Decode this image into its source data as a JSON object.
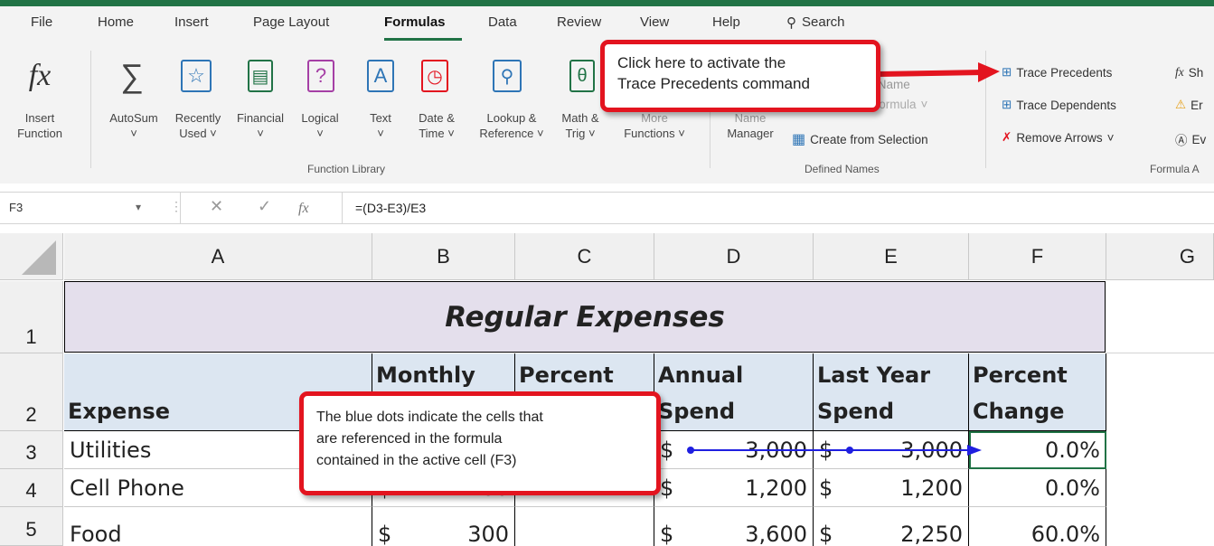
{
  "tabs": [
    "File",
    "Home",
    "Insert",
    "Page Layout",
    "Formulas",
    "Data",
    "Review",
    "View",
    "Help"
  ],
  "search_label": "Search",
  "ribbon": {
    "insert_function": [
      "Insert",
      "Function"
    ],
    "autosum": "AutoSum",
    "recently_used": [
      "Recently",
      "Used"
    ],
    "financial": "Financial",
    "logical": "Logical",
    "text": "Text",
    "date_time": [
      "Date &",
      "Time"
    ],
    "lookup_reference": [
      "Lookup &",
      "Reference"
    ],
    "math_trig": [
      "Math &",
      "Trig"
    ],
    "more_functions": [
      "More",
      "Functions"
    ],
    "function_library_label": "Function Library",
    "name_manager": [
      "Name",
      "Manager"
    ],
    "define_name": "Define Name",
    "use_in_formula": "Use in Formula",
    "create_from_selection": "Create from Selection",
    "defined_names_label": "Defined Names",
    "trace_precedents": "Trace Precedents",
    "trace_dependents": "Trace Dependents",
    "remove_arrows": "Remove Arrows",
    "show_formulas_partial": "Sh",
    "error_checking_partial": "Er",
    "evaluate_partial": "Ev",
    "formula_auditing_label": "Formula A"
  },
  "formula_bar": {
    "name_box": "F3",
    "formula": "=(D3-E3)/E3",
    "fx": "fx"
  },
  "columns": [
    "A",
    "B",
    "C",
    "D",
    "E",
    "F",
    "G"
  ],
  "rows": [
    "1",
    "2",
    "3",
    "4",
    "5"
  ],
  "sheet": {
    "title": "Regular Expenses",
    "headers": {
      "A": [
        "",
        "Expense"
      ],
      "B": [
        "Monthly",
        ""
      ],
      "C": [
        "Percent",
        ""
      ],
      "D": [
        "Annual",
        "Spend"
      ],
      "E": [
        "Last Year",
        "Spend"
      ],
      "F": [
        "Percent",
        "Change"
      ]
    },
    "data": [
      {
        "expense": "Utilities",
        "annual": "3,000",
        "last_year": "3,000",
        "change": "0.0%"
      },
      {
        "expense": "Cell Phone",
        "monthly": "100",
        "annual": "1,200",
        "last_year": "1,200",
        "change": "0.0%"
      },
      {
        "expense": "Food",
        "monthly": "300",
        "annual": "3,600",
        "last_year": "2,250",
        "change": "60.0%"
      }
    ],
    "currency": "$"
  },
  "callouts": {
    "trace": [
      "Click here to activate the",
      "Trace Precedents command"
    ],
    "dots": [
      "The blue dots indicate the cells that",
      "are referenced in the formula",
      "contained in the active cell (F3)"
    ]
  },
  "colors": {
    "excel_green": "#217346",
    "callout_red": "#e3141f",
    "trace_blue": "#1f1fe0",
    "title_fill": "#e4dfec",
    "header_fill": "#dce6f1"
  }
}
